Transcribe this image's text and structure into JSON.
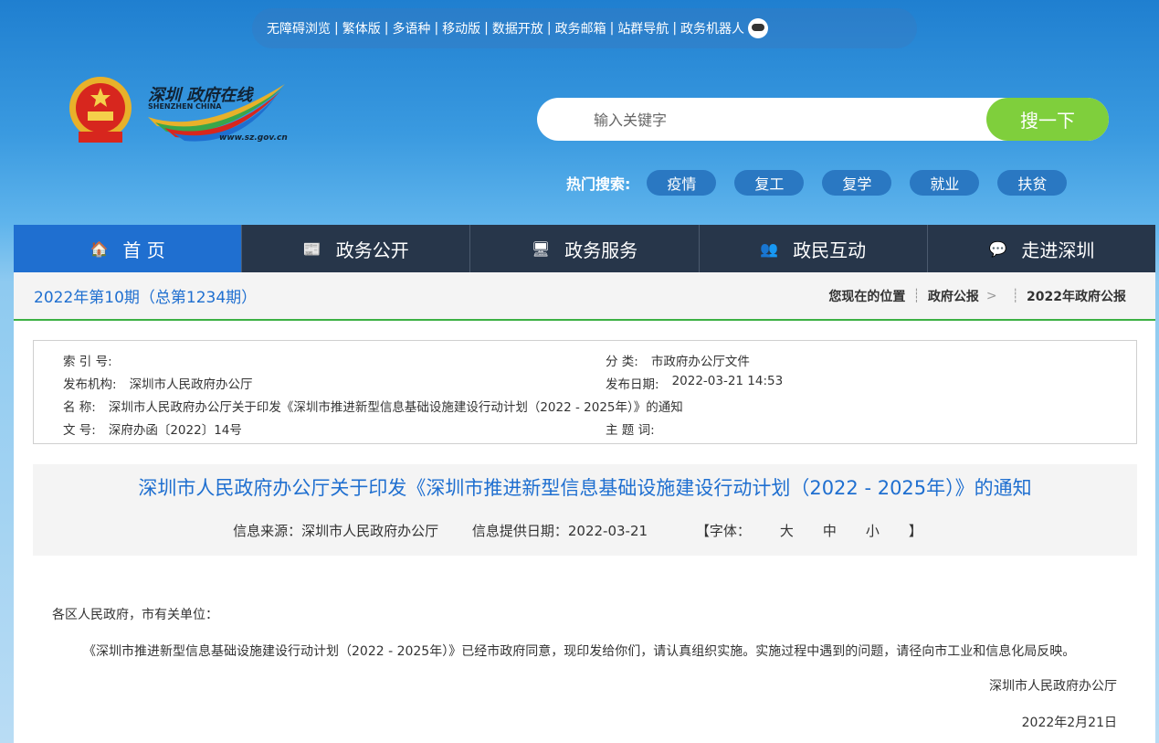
{
  "toplinks": {
    "items": [
      "无障碍浏览",
      "繁体版",
      "多语种",
      "移动版",
      "数据开放",
      "政务邮箱",
      "站群导航",
      "政务机器人"
    ]
  },
  "logo": {
    "cn": "深圳 政府在线",
    "en": "SHENZHEN  CHINA",
    "url": "www.sz.gov.cn"
  },
  "search": {
    "placeholder": "输入关键字",
    "button": "搜一下"
  },
  "hot": {
    "label": "热门搜索:",
    "tags": [
      "疫情",
      "复工",
      "复学",
      "就业",
      "扶贫"
    ]
  },
  "nav": {
    "items": [
      {
        "label": "首 页",
        "icon": "home-icon",
        "glyph": "🏠"
      },
      {
        "label": "政务公开",
        "icon": "news-icon",
        "glyph": "📰"
      },
      {
        "label": "政务服务",
        "icon": "monitor-icon",
        "glyph": "🖥"
      },
      {
        "label": "政民互动",
        "icon": "users-icon",
        "glyph": "👥"
      },
      {
        "label": "走进深圳",
        "icon": "chat-icon",
        "glyph": "💬"
      }
    ],
    "active_index": 0
  },
  "subhead": {
    "issue": "2022年第10期（总第1234期）",
    "location_label": "您现在的位置",
    "crumb1": "政府公报",
    "crumb_sep": ">",
    "crumb2": "2022年政府公报"
  },
  "meta": {
    "index_label": "索 引 号:",
    "index_value": "",
    "category_label": "分 类:",
    "category_value": "市政府办公厅文件",
    "publisher_label": "发布机构:",
    "publisher_value": "深圳市人民政府办公厅",
    "pubdate_label": "发布日期:",
    "pubdate_value": "2022-03-21 14:53",
    "name_label": "名 称:",
    "name_value": "深圳市人民政府办公厅关于印发《深圳市推进新型信息基础设施建设行动计划（2022 - 2025年）》的通知",
    "docno_label": "文 号:",
    "docno_value": "深府办函〔2022〕14号",
    "keywords_label": "主 题 词:",
    "keywords_value": ""
  },
  "doc": {
    "title": "深圳市人民政府办公厅关于印发《深圳市推进新型信息基础设施建设行动计划（2022 - 2025年）》的通知",
    "source": "信息来源：深圳市人民政府办公厅",
    "date": "信息提供日期：2022-03-21",
    "font_label": "【字体：",
    "font_big": "大",
    "font_mid": "中",
    "font_small": "小",
    "font_end": "】",
    "greeting": "各区人民政府，市有关单位：",
    "paragraph": "《深圳市推进新型信息基础设施建设行动计划（2022 - 2025年）》已经市政府同意，现印发给你们，请认真组织实施。实施过程中遇到的问题，请径向市工业和信息化局反映。",
    "signature": "深圳市人民政府办公厅",
    "signed_date": "2022年2月21日"
  }
}
